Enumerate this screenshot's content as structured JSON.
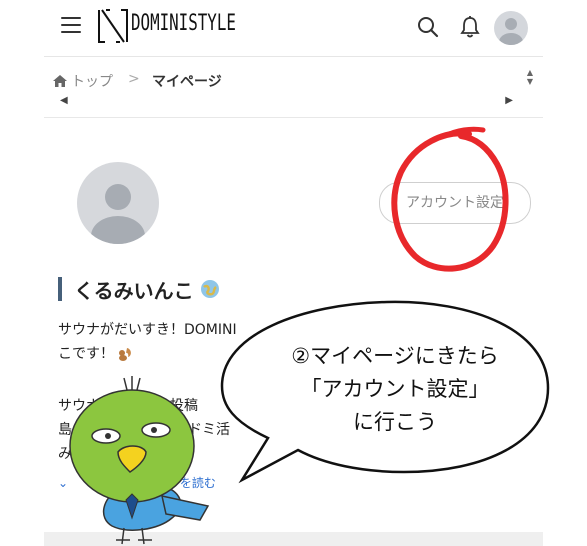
{
  "header": {
    "logo_text": "DOMINISTYLE"
  },
  "breadcrumb": {
    "home_label": "トップ",
    "separator": ">",
    "current_label": "マイページ"
  },
  "profile": {
    "account_button_label": "アカウント設定",
    "name": "くるみいんこ",
    "bio_line1": "サウナがだいすき！DOMINI",
    "bio_line2": "こです！",
    "bio2_line1": "サウナ",
    "bio2_line1b": "の投稿",
    "bio2_line2": "島",
    "bio2_line2b": "ドミ活",
    "bio2_line3": "み",
    "read_more_label": "を読む"
  },
  "callout": {
    "line1": "②マイページにきたら",
    "line2": "「アカウント設定」",
    "line3": "に行こう"
  },
  "colors": {
    "accent_red": "#e8282b",
    "link_blue": "#2e6fd0",
    "bird_green": "#8cc63f",
    "bird_blue": "#4aa3e0"
  }
}
